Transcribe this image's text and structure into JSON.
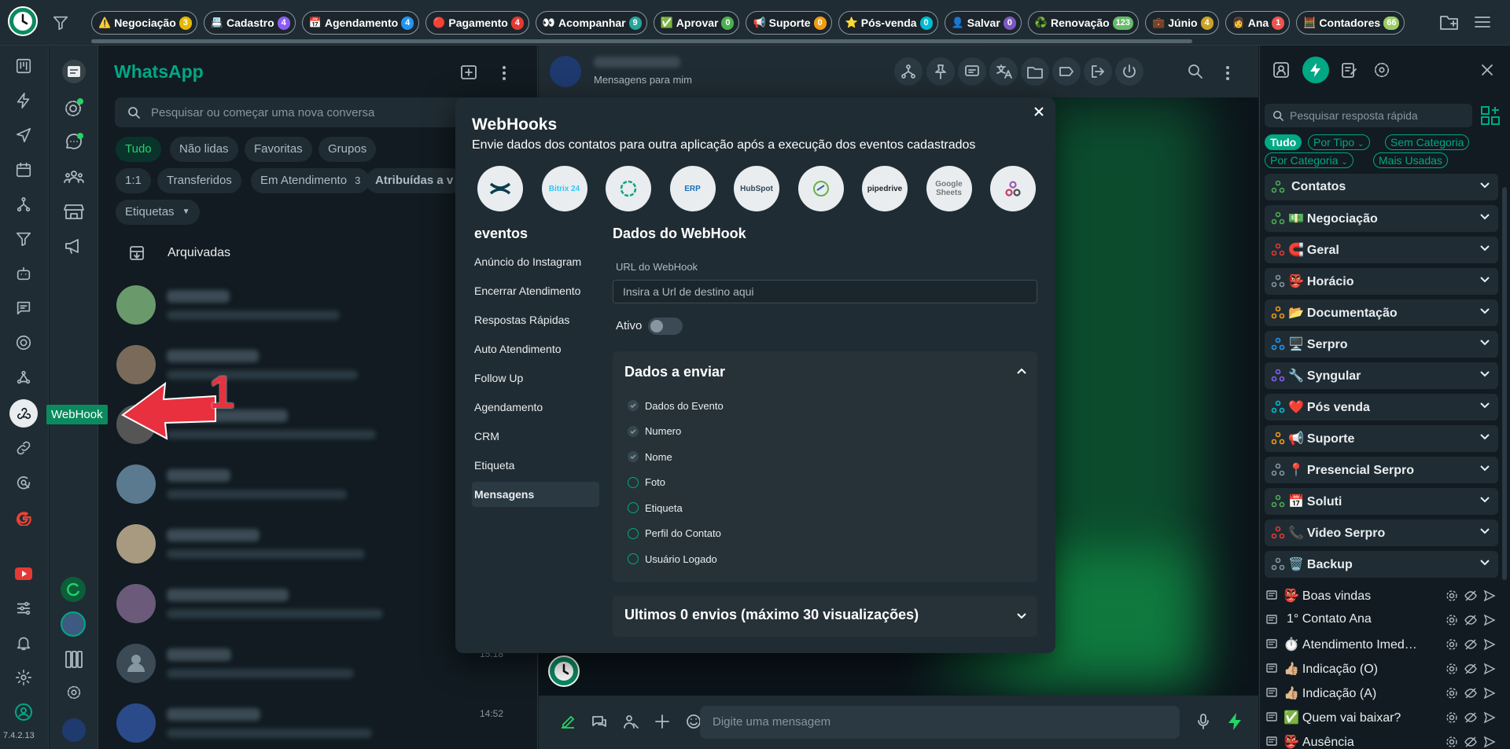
{
  "topbar": {
    "tags": [
      {
        "emoji": "⚠️",
        "label": "Negociação",
        "count": "3",
        "color": "#e6b800"
      },
      {
        "emoji": "📇",
        "label": "Cadastro",
        "count": "4",
        "color": "#8b5cf6"
      },
      {
        "emoji": "📅",
        "label": "Agendamento",
        "count": "4",
        "color": "#2196f3"
      },
      {
        "emoji": "🔴",
        "label": "Pagamento",
        "count": "4",
        "color": "#e53935"
      },
      {
        "emoji": "👀",
        "label": "Acompanhar",
        "count": "9",
        "color": "#26a69a"
      },
      {
        "emoji": "✅",
        "label": "Aprovar",
        "count": "0",
        "color": "#4caf50"
      },
      {
        "emoji": "📢",
        "label": "Suporte",
        "count": "0",
        "color": "#f39c12"
      },
      {
        "emoji": "⭐",
        "label": "Pós-venda",
        "count": "0",
        "color": "#00bcd4"
      },
      {
        "emoji": "👤",
        "label": "Salvar",
        "count": "0",
        "color": "#7e57c2"
      },
      {
        "emoji": "♻️",
        "label": "Renovação",
        "count": "123",
        "color": "#66bb6a"
      },
      {
        "emoji": "💼",
        "label": "Júnio",
        "count": "4",
        "color": "#c9a227"
      },
      {
        "emoji": "👩",
        "label": "Ana",
        "count": "1",
        "color": "#ef5350"
      },
      {
        "emoji": "🧮",
        "label": "Contadores",
        "count": "66",
        "color": "#9ccc65"
      }
    ]
  },
  "nav": {
    "tooltip": "WebHook",
    "version": "7.4.2.13"
  },
  "list": {
    "title": "WhatsApp",
    "search_placeholder": "Pesquisar ou começar uma nova conversa",
    "filters_row1": [
      "Tudo",
      "Não lidas",
      "Favoritas",
      "Grupos"
    ],
    "filters_row2": [
      "1:1",
      "Transferidos",
      "Em Atendimento",
      "Atribuídas a v"
    ],
    "em_atendimento_count": "3",
    "etiquetas": "Etiquetas",
    "archived": "Arquivadas",
    "times": [
      "15:18",
      "14:52"
    ]
  },
  "chat": {
    "subtitle": "Mensagens para mim",
    "message_placeholder": "Digite uma mensagem"
  },
  "modal": {
    "title": "WebHooks",
    "subtitle": "Envie dados dos contatos para outra aplicação após a execução dos eventos cadastrados",
    "integrations": [
      {
        "name": "sendflow-logo",
        "label": "",
        "bg": "#e9edef",
        "fg": "#0b3d4c"
      },
      {
        "name": "bitrix24-logo",
        "label": "Bitrix 24",
        "bg": "#e9edef",
        "fg": "#2fc6f6"
      },
      {
        "name": "openai-logo",
        "label": "",
        "bg": "#e9edef",
        "fg": "#10a37f"
      },
      {
        "name": "erp-logo",
        "label": "ERP",
        "bg": "#e9edef",
        "fg": "#1e6fb8"
      },
      {
        "name": "hubspot-logo",
        "label": "HubSpot",
        "bg": "#e9edef",
        "fg": "#33475b"
      },
      {
        "name": "agendor-logo",
        "label": "",
        "bg": "#e9edef",
        "fg": "#6ab04c"
      },
      {
        "name": "pipedrive-logo",
        "label": "pipedrive",
        "bg": "#e9edef",
        "fg": "#26292c"
      },
      {
        "name": "google-sheets-logo",
        "label": "Google Sheets",
        "bg": "#e9edef",
        "fg": "#777"
      },
      {
        "name": "webhook-logo",
        "label": "",
        "bg": "#e9edef",
        "fg": "#c73a63"
      }
    ],
    "events_title": "eventos",
    "events": [
      "Anúncio do Instagram",
      "Encerrar Atendimento",
      "Respostas Rápidas",
      "Auto Atendimento",
      "Follow Up",
      "Agendamento",
      "CRM",
      "Etiqueta",
      "Mensagens"
    ],
    "selected_event": "Mensagens",
    "webhook_title": "Dados do WebHook",
    "url_label": "URL do WebHook",
    "url_placeholder": "Insira a Url de destino aqui",
    "ativo_label": "Ativo",
    "ativo_on": false,
    "dados_title": "Dados a enviar",
    "dados": [
      {
        "label": "Dados do Evento",
        "checked": true
      },
      {
        "label": "Numero",
        "checked": true
      },
      {
        "label": "Nome",
        "checked": true
      },
      {
        "label": "Foto",
        "checked": false
      },
      {
        "label": "Etiqueta",
        "checked": false
      },
      {
        "label": "Perfil do Contato",
        "checked": false
      },
      {
        "label": "Usuário Logado",
        "checked": false
      }
    ],
    "ultimos_title": "Ultimos 0 envios (máximo 30 visualizações)"
  },
  "right": {
    "search_placeholder": "Pesquisar resposta rápida",
    "filters": [
      "Tudo",
      "Por Tipo",
      "Sem Categoria",
      "Por Categoria",
      "Mais Usadas"
    ],
    "categories": [
      {
        "emoji": "",
        "label": "Contatos",
        "tri": "#4caf50"
      },
      {
        "emoji": "💵",
        "label": "Negociação",
        "tri": "#4caf50"
      },
      {
        "emoji": "🧲",
        "label": "Geral",
        "tri": "#e53935"
      },
      {
        "emoji": "👺",
        "label": "Horácio",
        "tri": "#8696a0"
      },
      {
        "emoji": "📂",
        "label": "Documentação",
        "tri": "#f39c12"
      },
      {
        "emoji": "🖥️",
        "label": "Serpro",
        "tri": "#2196f3"
      },
      {
        "emoji": "🔧",
        "label": "Syngular",
        "tri": "#8b5cf6"
      },
      {
        "emoji": "❤️",
        "label": "Pós venda",
        "tri": "#00bcd4"
      },
      {
        "emoji": "📢",
        "label": "Suporte",
        "tri": "#f39c12"
      },
      {
        "emoji": "📍",
        "label": "Presencial Serpro",
        "tri": "#8696a0"
      },
      {
        "emoji": "📅",
        "label": "Soluti",
        "tri": "#4caf50"
      },
      {
        "emoji": "📞",
        "label": "Video Serpro",
        "tri": "#e53935"
      },
      {
        "emoji": "🗑️",
        "label": "Backup",
        "tri": "#8696a0"
      }
    ],
    "quick_replies": [
      {
        "emoji": "👺",
        "label": "Boas vindas"
      },
      {
        "emoji": "",
        "label": "1° Contato Ana"
      },
      {
        "emoji": "⏱️",
        "label": "Atendimento Imediato"
      },
      {
        "emoji": "👍🏼",
        "label": "Indicação (O)"
      },
      {
        "emoji": "👍🏼",
        "label": "Indicação (A)"
      },
      {
        "emoji": "✅",
        "label": "Quem vai baixar?"
      },
      {
        "emoji": "👺",
        "label": "Ausência"
      }
    ]
  },
  "annotation": {
    "number": "1",
    "color": "#e8303f"
  }
}
